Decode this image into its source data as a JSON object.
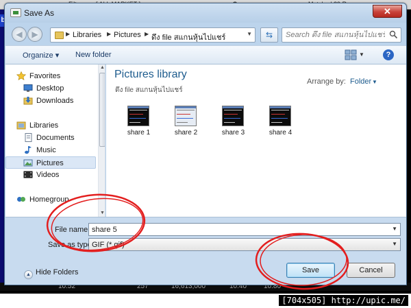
{
  "background_app": {
    "filter_label": "Filter :",
    "filter_value": "[ ALL MARKET ]",
    "scan_label": "Scan",
    "status_text": "Matched 29 Rec",
    "side_letter": "b",
    "bottom_values": [
      "10.52",
      "257",
      "16,613,000",
      "10.40",
      "10.80"
    ]
  },
  "dialog": {
    "title": "Save As",
    "close_glyph": "✕"
  },
  "address": {
    "crumbs": [
      "Libraries",
      "Pictures",
      "ดึง file สแกนหุ้นไปแชร์"
    ],
    "search_placeholder": "Search ดึง file สแกนหุ้นไปแชร์"
  },
  "toolbar": {
    "organize_label": "Organize ▾",
    "new_folder_label": "New folder",
    "help_glyph": "?"
  },
  "nav": {
    "items": [
      {
        "label": "Favorites",
        "icon": "star-icon"
      },
      {
        "label": "Desktop",
        "icon": "desktop-icon"
      },
      {
        "label": "Downloads",
        "icon": "downloads-icon"
      },
      {
        "label": "Libraries",
        "icon": "libraries-icon"
      },
      {
        "label": "Documents",
        "icon": "documents-icon"
      },
      {
        "label": "Music",
        "icon": "music-icon"
      },
      {
        "label": "Pictures",
        "icon": "pictures-icon",
        "selected": true
      },
      {
        "label": "Videos",
        "icon": "videos-icon"
      },
      {
        "label": "Homegroup",
        "icon": "homegroup-icon"
      }
    ]
  },
  "content": {
    "library_title": "Pictures library",
    "library_subtitle": "ดึง file สแกนหุ้นไปแชร์",
    "arrange_label": "Arrange by:",
    "arrange_value": "Folder",
    "files": [
      {
        "name": "share 1",
        "style": "dark"
      },
      {
        "name": "share 2",
        "style": "light"
      },
      {
        "name": "share 3",
        "style": "dark"
      },
      {
        "name": "share 4",
        "style": "dark"
      }
    ]
  },
  "form": {
    "file_name_label": "File name:",
    "file_name_value": "share 5",
    "save_type_label": "Save as type:",
    "save_type_value": "GIF (*.gif)",
    "hide_folders_label": "Hide Folders",
    "save_label": "Save",
    "cancel_label": "Cancel"
  },
  "colors": {
    "annotation_red": "#e31e1e",
    "link_blue": "#1e5c8e",
    "title_bar": "#bcd4ec"
  },
  "watermark": "[704x505] http://upic.me/"
}
